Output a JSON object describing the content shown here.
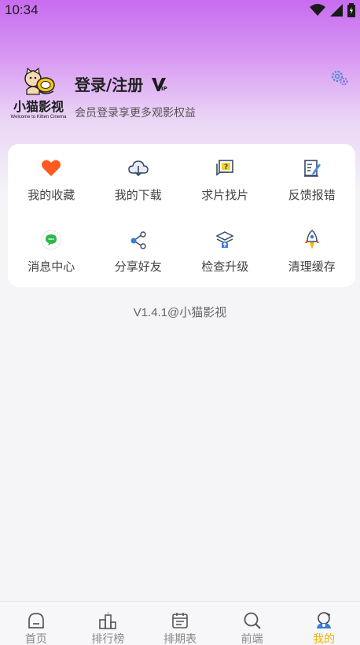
{
  "status_bar": {
    "time": "10:34"
  },
  "profile": {
    "logo_title": "小猫影视",
    "logo_subtitle": "Welcome to Kitten Cinema",
    "login_title": "登录/注册",
    "subtitle": "会员登录享更多观影权益"
  },
  "menu": [
    {
      "label": "我的收藏",
      "icon": "heart-icon"
    },
    {
      "label": "我的下载",
      "icon": "cloud-download-icon"
    },
    {
      "label": "求片找片",
      "icon": "question-message-icon"
    },
    {
      "label": "反馈报错",
      "icon": "feedback-edit-icon"
    },
    {
      "label": "消息中心",
      "icon": "message-bubble-icon"
    },
    {
      "label": "分享好友",
      "icon": "share-icon"
    },
    {
      "label": "检查升级",
      "icon": "upgrade-icon"
    },
    {
      "label": "清理缓存",
      "icon": "rocket-icon"
    }
  ],
  "version_text": "V1.4.1@小猫影视",
  "tabs": [
    {
      "label": "首页",
      "icon": "home-icon"
    },
    {
      "label": "排行榜",
      "icon": "ranking-icon"
    },
    {
      "label": "排期表",
      "icon": "calendar-icon"
    },
    {
      "label": "前端",
      "icon": "search-icon"
    },
    {
      "label": "我的",
      "icon": "profile-icon",
      "active": true
    }
  ],
  "colors": {
    "accent": "#f0b400",
    "heart": "#ff5a1f",
    "message": "#2db84d",
    "share": "#3a7bd5"
  }
}
